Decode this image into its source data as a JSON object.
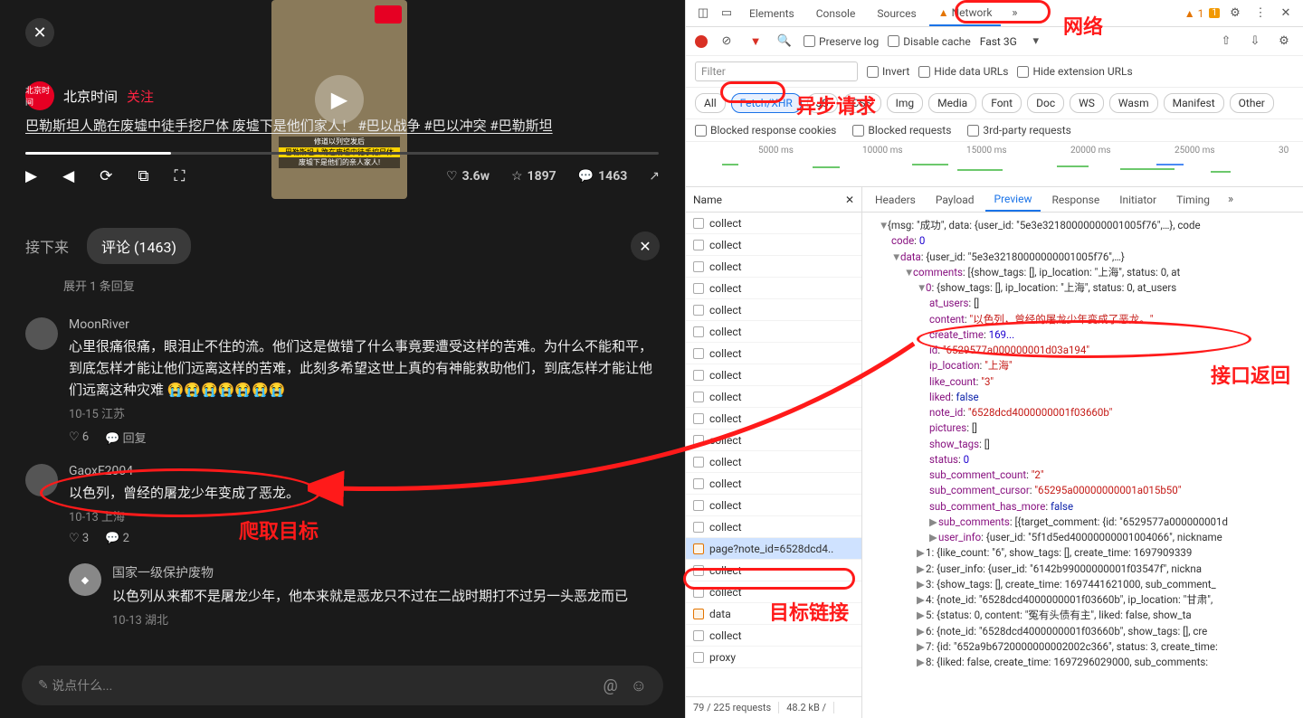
{
  "video": {
    "close": "✕",
    "author": "北京时间",
    "author_badge": "北京时间",
    "follow": "关注",
    "title": "巴勒斯坦人跪在废墟中徒手挖尸体 废墟下是他们家人！ #巴以战争 #巴以冲突 #巴勒斯坦",
    "thumb_l1": "修道以列空发后",
    "thumb_l2": "巴勒斯坦人跪在废墟中徒手挖尸体",
    "thumb_l3": "废墟下是他们的亲人家人!",
    "likes": "3.6w",
    "stars": "1897",
    "comments": "1463"
  },
  "tabs": {
    "next": "接下来",
    "comments": "评论 (1463)",
    "expand": "展开 1 条回复"
  },
  "comment_list": [
    {
      "user": "MoonRiver",
      "text": "心里很痛很痛，眼泪止不住的流。他们这是做错了什么事竟要遭受这样的苦难。为什么不能和平，到底怎样才能让他们远离这样的苦难，此刻多希望这世上真的有神能救助他们，到底怎样才能让他们远离这种灾难 😭😭😭😭😭😭😭",
      "meta": "10-15 江苏",
      "likes": "6",
      "reply": "回复"
    },
    {
      "user": "GaoxF2004",
      "text": "以色列，曾经的屠龙少年变成了恶龙。",
      "meta": "10-13 上海",
      "likes": "3",
      "replies": "2"
    },
    {
      "user": "国家一级保护废物",
      "text": "以色列从来都不是屠龙少年，他本来就是恶龙只不过在二战时期打不过另一头恶龙而已",
      "meta": "10-13 湖北"
    }
  ],
  "reply_placeholder": "说点什么...",
  "devtools": {
    "tabs": [
      "Elements",
      "Console",
      "Sources",
      "Network"
    ],
    "warn_count": "1",
    "issue_count": "1",
    "preserve": "Preserve log",
    "disable_cache": "Disable cache",
    "throttle": "Fast 3G",
    "filter_placeholder": "Filter",
    "invert": "Invert",
    "hide_data": "Hide data URLs",
    "hide_ext": "Hide extension URLs",
    "chips": [
      "All",
      "Fetch/XHR",
      "JS",
      "CSS",
      "Img",
      "Media",
      "Font",
      "Doc",
      "WS",
      "Wasm",
      "Manifest",
      "Other"
    ],
    "blocked_cookies": "Blocked response cookies",
    "blocked_req": "Blocked requests",
    "third_party": "3rd-party requests",
    "ticks": [
      "5000 ms",
      "10000 ms",
      "15000 ms",
      "20000 ms",
      "25000 ms",
      "30"
    ],
    "name_header": "Name",
    "requests": [
      "collect",
      "collect",
      "collect",
      "collect",
      "collect",
      "collect",
      "collect",
      "collect",
      "collect",
      "collect",
      "collect",
      "collect",
      "collect",
      "collect",
      "collect",
      "page?note_id=6528dcd4..",
      "collect",
      "collect",
      "data",
      "collect",
      "proxy"
    ],
    "selected_index": 15,
    "footer_a": "79 / 225 requests",
    "footer_b": "48.2 kB /",
    "detail_tabs": [
      "Headers",
      "Payload",
      "Preview",
      "Response",
      "Initiator",
      "Timing"
    ]
  },
  "json_preview": {
    "root": "{msg: \"成功\", data: {user_id: \"5e3e32180000000001005f76\",…}, code",
    "code": "0",
    "user_id": "5e3e32180000000001005f76",
    "comments_line": "[{show_tags: [], ip_location: \"上海\", status: 0, at",
    "item0_head": "{show_tags: [], ip_location: \"上海\", status: 0, at_users",
    "at_users": "[]",
    "content": "\"以色列，曾经的屠龙少年变成了恶龙。\"",
    "id": "\"6529577a000000001d03a194\"",
    "ip_location": "\"上海\"",
    "like_count": "\"3\"",
    "liked": "false",
    "note_id": "\"6528dcd4000000001f03660b\"",
    "pictures": "[]",
    "show_tags": "[]",
    "status": "0",
    "sub_comment_count": "\"2\"",
    "sub_comment_cursor": "\"65295a00000000001a015b50\"",
    "sub_comment_has_more": "false",
    "sub_comments": "[{target_comment: {id: \"6529577a000000001d",
    "user_info": "{user_id: \"5f1d5ed40000000001004066\", nickname",
    "rows": [
      "1: {like_count: \"6\", show_tags: [], create_time: 1697909339",
      "2: {user_info: {user_id: \"6142b99000000001f03547f\", nickna",
      "3: {show_tags: [], create_time: 1697441621000, sub_comment_",
      "4: {note_id: \"6528dcd4000000001f03660b\", ip_location: \"甘肃\",",
      "5: {status: 0, content: \"冤有头债有主\", liked: false, show_ta",
      "6: {note_id: \"6528dcd4000000001f03660b\", show_tags: [], cre",
      "7: {id: \"652a9b6720000000002002c366\", status: 3, create_time:",
      "8: {liked: false, create_time: 1697296029000, sub_comments:"
    ]
  },
  "annotations": {
    "network": "网络",
    "async": "异步请求",
    "api_return": "接口返回",
    "target_link": "目标链接",
    "crawl_target": "爬取目标"
  }
}
